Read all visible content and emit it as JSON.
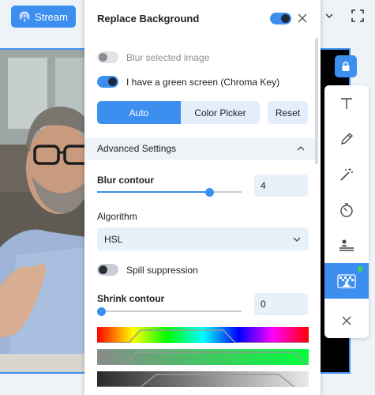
{
  "topbar": {
    "stream_label": "Stream",
    "icons": [
      "broadcast-icon",
      "chevron-down-icon",
      "fullscreen-icon"
    ]
  },
  "video": {
    "lock_icon": "lock-icon"
  },
  "toolbar": {
    "tools": [
      {
        "name": "text",
        "icon": "text-icon"
      },
      {
        "name": "draw",
        "icon": "pencil-icon"
      },
      {
        "name": "effects",
        "icon": "magic-wand-icon"
      },
      {
        "name": "timer",
        "icon": "timer-icon"
      },
      {
        "name": "lower-third",
        "icon": "lower-third-icon"
      },
      {
        "name": "replace-background",
        "icon": "chroma-key-icon",
        "active": true
      },
      {
        "name": "close",
        "icon": "close-icon"
      }
    ]
  },
  "panel": {
    "title": "Replace Background",
    "enabled": true,
    "blur_selected_label": "Blur selected image",
    "blur_selected_on": false,
    "green_screen_label": "I have a green screen (Chroma Key)",
    "green_screen_on": true,
    "mode_auto": "Auto",
    "mode_picker": "Color Picker",
    "reset_label": "Reset",
    "advanced_label": "Advanced Settings",
    "blur_contour_label": "Blur contour",
    "blur_contour_value": "4",
    "blur_contour_fraction": 0.78,
    "algorithm_label": "Algorithm",
    "algorithm_value": "HSL",
    "spill_label": "Spill suppression",
    "spill_on": false,
    "shrink_label": "Shrink contour",
    "shrink_value": "0",
    "shrink_fraction": 0.0
  },
  "colors": {
    "accent": "#3d8fef",
    "toolbar_active_dot": "#3fd35a"
  }
}
